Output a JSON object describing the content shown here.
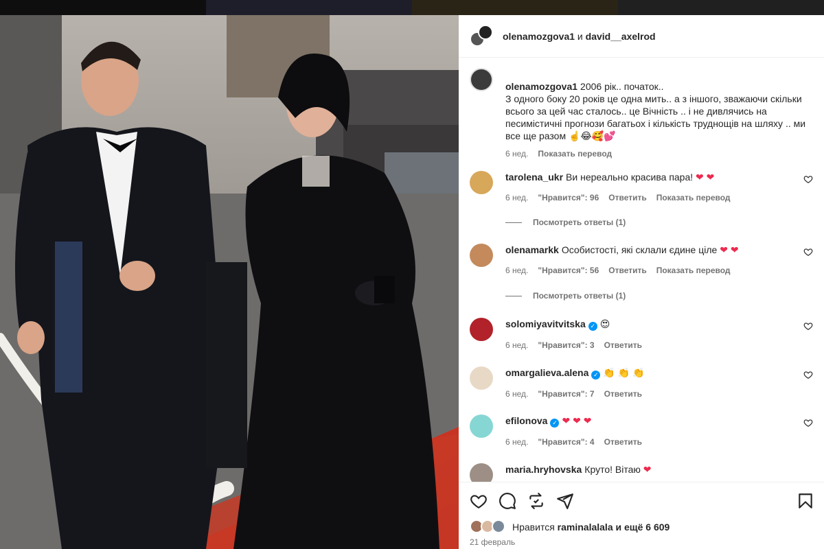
{
  "colors": {
    "accent_blue": "#0095f6",
    "heart_red": "#ed2a4e",
    "text_main": "#262626",
    "text_muted": "#737373"
  },
  "header": {
    "user1": "olenamozgova1",
    "conj": "и",
    "user2": "david__axelrod"
  },
  "caption": {
    "username": "olenamozgova1",
    "text": "2006 рік.. початок..\nЗ одного боку 20 років це одна мить.. а з іншого, зважаючи скільки всього за цей час сталось.. це Вічність .. і не дивлячись на песимістичні прогнози багатьох і кількість труднощів на шляху .. ми все ще разом ☝️😂🥰💕",
    "time": "6 нед.",
    "translate": "Показать перевод"
  },
  "comments": [
    {
      "username": "tarolena_ukr",
      "verified": false,
      "text": "Ви нереально красива пара! ❤️ ❤️",
      "time": "6 нед.",
      "likes": "\"Нравится\": 96",
      "reply": "Ответить",
      "translate": "Показать перевод",
      "replies": "Посмотреть ответы (1)"
    },
    {
      "username": "olenamarkk",
      "verified": false,
      "text": "Особистості, які склали єдине ціле ❤️ ❤️",
      "time": "6 нед.",
      "likes": "\"Нравится\": 56",
      "reply": "Ответить",
      "translate": "Показать перевод",
      "replies": "Посмотреть ответы (1)"
    },
    {
      "username": "solomiyavitvitska",
      "verified": true,
      "text": "😍",
      "time": "6 нед.",
      "likes": "\"Нравится\": 3",
      "reply": "Ответить"
    },
    {
      "username": "omargalieva.alena",
      "verified": true,
      "text": "👏 👏 👏",
      "time": "6 нед.",
      "likes": "\"Нравится\": 7",
      "reply": "Ответить"
    },
    {
      "username": "efilonova",
      "verified": true,
      "text": "❤️ ❤️ ❤️",
      "time": "6 нед.",
      "likes": "\"Нравится\": 4",
      "reply": "Ответить"
    },
    {
      "username": "maria.hryhovska",
      "verified": false,
      "text": "Круто! Вітаю ❤️"
    }
  ],
  "actions": {
    "likes_prefix": "Нравится",
    "likes_user": "raminalalala",
    "likes_suffix": "и ещё 6 609",
    "date": "21 февраль"
  },
  "icons": [
    "heart-icon",
    "comment-icon",
    "repost-icon",
    "share-icon",
    "bookmark-icon"
  ]
}
